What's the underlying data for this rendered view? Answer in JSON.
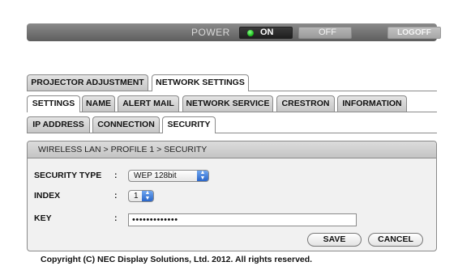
{
  "power_bar": {
    "label": "POWER",
    "on_label": "ON",
    "off_label": "OFF",
    "logoff_label": "LOGOFF",
    "on_indicator_color": "#22c022"
  },
  "main_tabs": [
    {
      "label": "PROJECTOR ADJUSTMENT",
      "active": false
    },
    {
      "label": "NETWORK SETTINGS",
      "active": true
    }
  ],
  "sub_tabs": [
    {
      "label": "SETTINGS",
      "active": true
    },
    {
      "label": "NAME",
      "active": false
    },
    {
      "label": "ALERT MAIL",
      "active": false
    },
    {
      "label": "NETWORK SERVICE",
      "active": false
    },
    {
      "label": "CRESTRON",
      "active": false
    },
    {
      "label": "INFORMATION",
      "active": false
    }
  ],
  "settings_tabs": [
    {
      "label": "IP ADDRESS",
      "active": false
    },
    {
      "label": "CONNECTION",
      "active": false
    },
    {
      "label": "SECURITY",
      "active": true
    }
  ],
  "panel": {
    "breadcrumb": "WIRELESS LAN > PROFILE 1 > SECURITY",
    "security_type": {
      "label": "SECURITY TYPE",
      "colon": ":",
      "value": "WEP 128bit"
    },
    "index": {
      "label": "INDEX",
      "colon": ":",
      "value": "1"
    },
    "key": {
      "label": "KEY",
      "colon": ":",
      "value": "•••••••••••••"
    },
    "save_label": "SAVE",
    "cancel_label": "CANCEL"
  },
  "footer": {
    "copyright": "Copyright (C) NEC Display Solutions, Ltd. 2012. All rights reserved."
  }
}
